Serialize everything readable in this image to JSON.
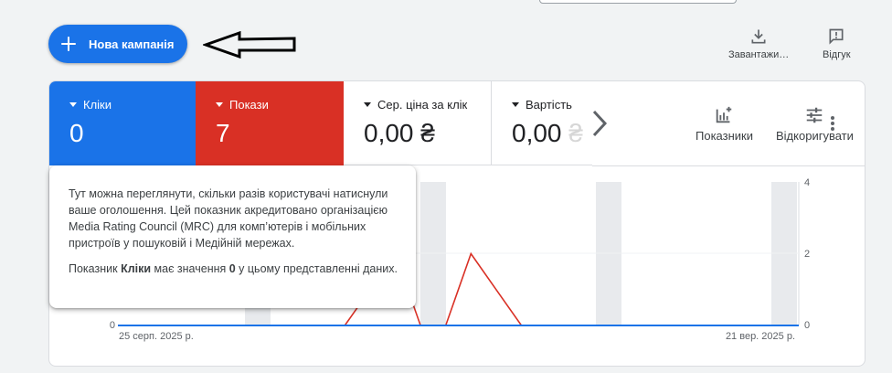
{
  "toolbar": {
    "new_campaign_label": "Нова кампанія",
    "download_label": "Завантажи…",
    "feedback_label": "Відгук"
  },
  "metrics": [
    {
      "label": "Кліки",
      "value": "0",
      "color": "#1a73e8"
    },
    {
      "label": "Покази",
      "value": "7",
      "color": "#d93025"
    },
    {
      "label": "Сер. ціна за клік",
      "value": "0,00 ₴"
    },
    {
      "label": "Вартість",
      "value": "0,00 ₴"
    }
  ],
  "actions": {
    "indicators_label": "Показники",
    "adjust_label": "Відкоригувати"
  },
  "tooltip": {
    "text": "Тут можна переглянути, скільки разів користувачі натиснули ваше оголошення. Цей показник акредитовано організацією Media Rating Council (MRC) для комп’ютерів і мобільних пристроїв у пошуковій і Медійній мережах.",
    "summary_prefix": "Показник ",
    "summary_metric": "Кліки",
    "summary_mid": " має значення ",
    "summary_value": "0",
    "summary_suffix": " у цьому представленні даних."
  },
  "chart_data": {
    "type": "line",
    "x_start_label": "25 серп. 2025 р.",
    "x_end_label": "21 вер. 2025 р.",
    "left_axis_ticks": [
      "0"
    ],
    "right_axis_ticks": [
      "4",
      "2",
      "0"
    ],
    "series": [
      {
        "name": "Кліки",
        "color": "#1a73e8",
        "values": [
          0,
          0,
          0,
          0,
          0,
          0,
          0,
          0,
          0,
          0,
          0,
          0,
          0,
          0,
          0,
          0,
          0,
          0,
          0,
          0,
          0,
          0,
          0,
          0,
          0,
          0,
          0,
          0
        ]
      },
      {
        "name": "Покази",
        "color": "#d93025",
        "values": [
          0,
          0,
          0,
          0,
          0,
          0,
          0,
          0,
          0,
          0,
          1,
          2,
          0,
          0,
          2,
          1,
          0,
          0,
          0,
          0,
          0,
          0,
          0,
          0,
          0,
          0,
          0,
          0
        ]
      }
    ],
    "grid": true
  }
}
